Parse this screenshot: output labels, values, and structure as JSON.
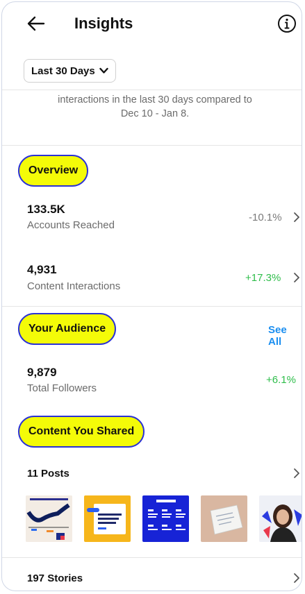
{
  "header": {
    "title": "Insights",
    "back_icon": "back-arrow-icon",
    "info_icon": "info-icon"
  },
  "range": {
    "label": "Last 30 Days",
    "chevron": "chevron-down-icon"
  },
  "summary": {
    "line1": "interactions in the last 30 days compared to",
    "line2": "Dec 10 - Jan 8."
  },
  "overview": {
    "heading": "Overview",
    "reached": {
      "value": "133.5K",
      "label": "Accounts Reached",
      "change": "-10.1%"
    },
    "interactions": {
      "value": "4,931",
      "label": "Content Interactions",
      "change": "+17.3%"
    }
  },
  "audience": {
    "heading": "Your Audience",
    "see_all": "See All",
    "followers": {
      "value": "9,879",
      "label": "Total Followers",
      "change": "+6.1%"
    }
  },
  "content": {
    "heading": "Content You Shared",
    "posts_label": "11 Posts",
    "stories_label": "197 Stories",
    "thumbnails": [
      "infographic-chart",
      "yellow-promo-card",
      "blue-grid-card",
      "paper-photo",
      "person-photo"
    ]
  },
  "colors": {
    "highlight": "#f4fb08",
    "outline": "#2a31d6",
    "positive": "#2ebd4a",
    "link": "#1a8ef0"
  }
}
